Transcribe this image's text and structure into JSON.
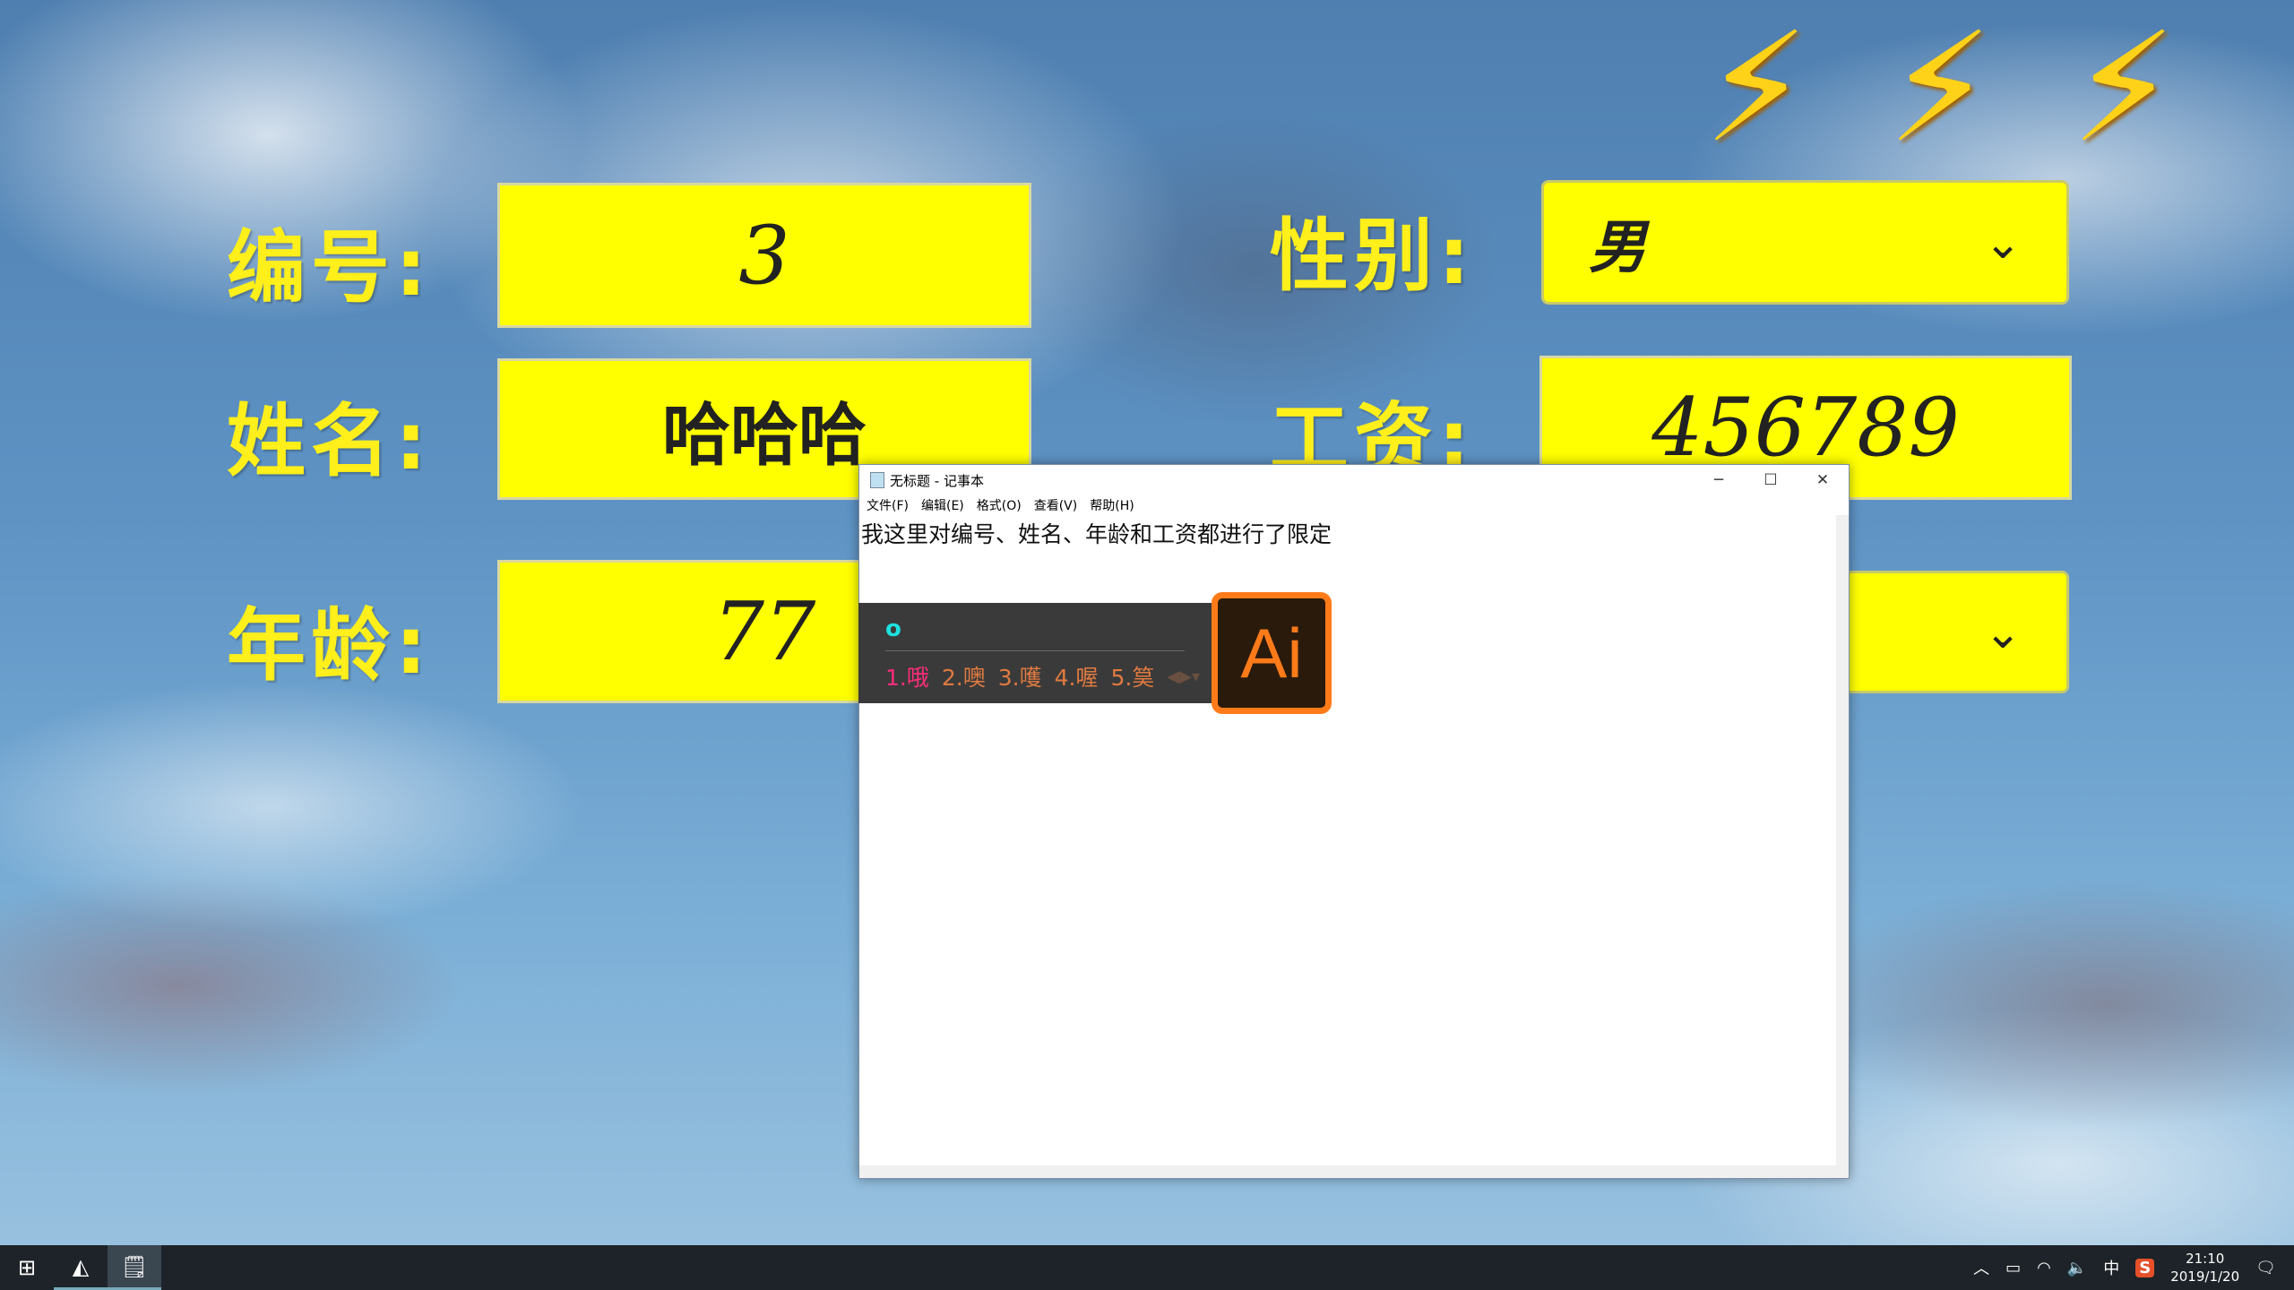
{
  "form": {
    "id_label": "编号:",
    "id_value": "3",
    "name_label": "姓名:",
    "name_value": "哈哈哈",
    "age_label": "年龄:",
    "age_value": "77",
    "gender_label": "性别:",
    "gender_value": "男",
    "salary_label": "工资:",
    "salary_value": "456789",
    "chevron": "⌄"
  },
  "notepad": {
    "title": "无标题 - 记事本",
    "menu": [
      "文件(F)",
      "编辑(E)",
      "格式(O)",
      "查看(V)",
      "帮助(H)"
    ],
    "content": "我这里对编号、姓名、年龄和工资都进行了限定"
  },
  "ime": {
    "input": "o",
    "candidates": [
      "1.哦",
      "2.噢",
      "3.嚄",
      "4.喔",
      "5.筽"
    ]
  },
  "ai_icon": {
    "text": "Ai"
  },
  "taskbar": {
    "time": "21:10",
    "date": "2019/1/20",
    "ime_mode": "中"
  },
  "colors": {
    "field": "#ffff00",
    "label": "#ffef1a",
    "ai": "#ff7b1a"
  }
}
